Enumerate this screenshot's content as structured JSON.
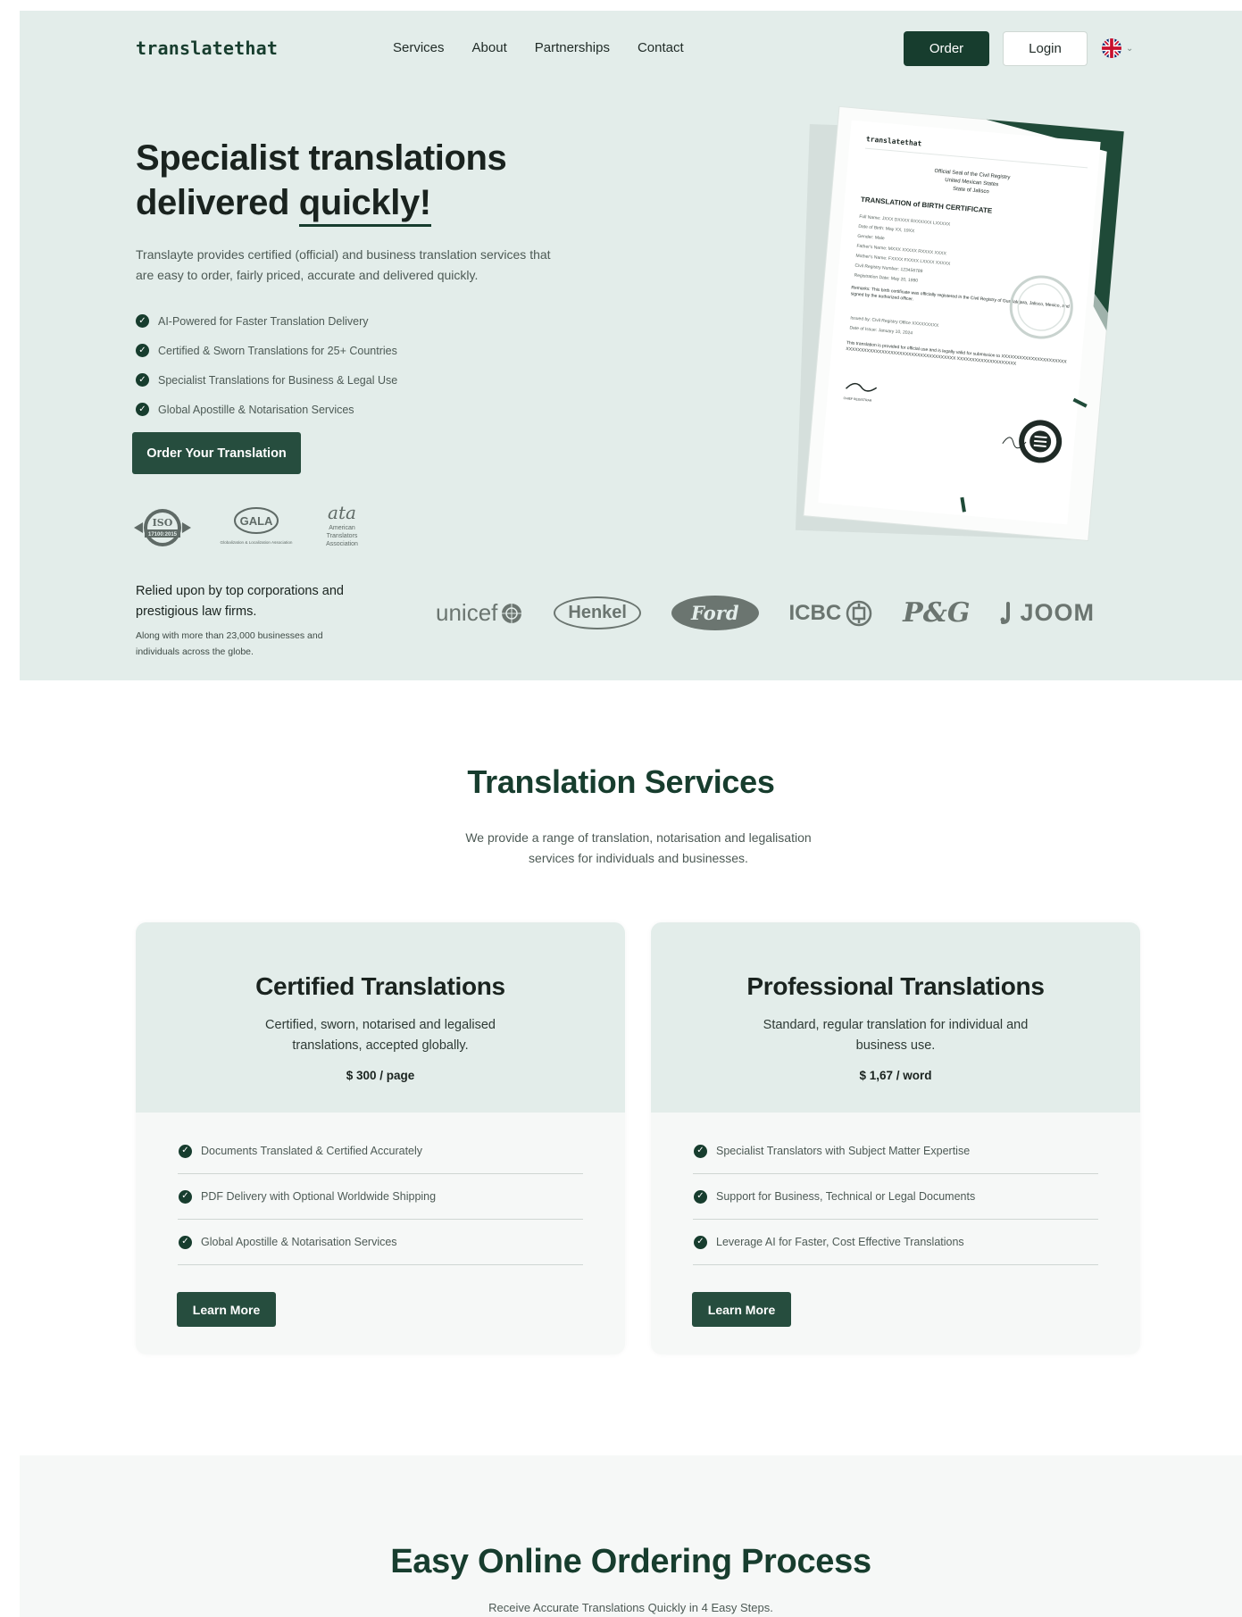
{
  "nav": {
    "logo": "translatethat",
    "links": [
      "Services",
      "About",
      "Partnerships",
      "Contact"
    ],
    "order_label": "Order",
    "login_label": "Login",
    "language_icon": "uk-flag-icon"
  },
  "hero": {
    "title_line1": "Specialist translations",
    "title_line2_prefix": "delivered ",
    "title_line2_highlight": "quickly!",
    "description": "Translayte provides certified (official) and business translation services that are easy to order, fairly priced, accurate and delivered quickly.",
    "features": [
      "AI-Powered for Faster Translation Delivery",
      "Certified & Sworn Translations for 25+ Countries",
      "Specialist Translations for Business & Legal Use",
      "Global Apostille & Notarisation Services"
    ],
    "cta_label": "Order Your Translation",
    "badges": {
      "iso": {
        "top": "ISO",
        "bottom": "17100:2015"
      },
      "gala": {
        "top": "GALA",
        "bottom": "Globalization & Localization Association"
      },
      "ata": {
        "top": "ata",
        "line1": "American",
        "line2": "Translators",
        "line3": "Association"
      }
    },
    "relied_main": "Relied upon by top corporations and prestigious law firms.",
    "relied_sub": "Along with more than 23,000 businesses and individuals across the globe.",
    "brands": [
      "unicef",
      "Henkel",
      "Ford",
      "ICBC",
      "P&G",
      "JOOM"
    ]
  },
  "certificate": {
    "logo": "translatethat",
    "seal_line1": "Official Seal of the Civil Registry",
    "seal_line2": "United Mexican States",
    "seal_line3": "State of Jalisco",
    "title": "TRANSLATION of BIRTH CERTIFICATE",
    "fields": [
      "Full Name: JXXX DXXXX RXXXXXX LXXXXX",
      "Date of Birth: May XX, 19XX",
      "Gender: Male",
      "Father's Name: MXXX XXXXX RXXXX XXXX",
      "Mother's Name: FXXXX FXXXX LXXXX XXXXX",
      "Civil Registry Number: 123456789",
      "Registration Date: May 20, 1990"
    ],
    "remarks": "Remarks: This birth certificate was officially registered in the Civil Registry of Guadalajara, Jalisco, Mexico, and signed by the authorized officer.",
    "issued_by": "Issued by: Civil Registry Office XXXXXXXXX",
    "date_issue": "Date of Issue: January 10, 2024",
    "footer": "This translation is provided for official use and is legally valid for submission to XXXXXXXXXXXXXXXXXXXXXXXXXXXXXXXXXXXXXXXXXXXXXXXXXXXXXXXXXXX XXXXXXXXXXXXXXXXXXXX",
    "registrar": "CHIEF REGISTRAR"
  },
  "services": {
    "title": "Translation Services",
    "description": "We provide a range of translation, notarisation and legalisation services for individuals and businesses.",
    "cards": [
      {
        "title": "Certified Translations",
        "description": "Certified, sworn, notarised and legalised translations, accepted globally.",
        "price": "$ 300 / page",
        "features": [
          "Documents Translated & Certified Accurately",
          "PDF Delivery with Optional Worldwide Shipping",
          "Global Apostille & Notarisation Services"
        ],
        "button": "Learn More"
      },
      {
        "title": "Professional Translations",
        "description": "Standard, regular translation for individual and business use.",
        "price": "$ 1,67 / word",
        "features": [
          "Specialist Translators with Subject Matter Expertise",
          "Support for Business, Technical or Legal Documents",
          "Leverage AI for Faster, Cost Effective Translations"
        ],
        "button": "Learn More"
      }
    ]
  },
  "ordering": {
    "title": "Easy Online Ordering Process",
    "subtitle": "Receive Accurate Translations Quickly in 4 Easy Steps."
  },
  "colors": {
    "primary": "#173d2e",
    "button": "#264d3e",
    "hero_bg": "#e3edea",
    "card_bottom": "#f6f8f7",
    "muted_text": "#4d5a55"
  }
}
